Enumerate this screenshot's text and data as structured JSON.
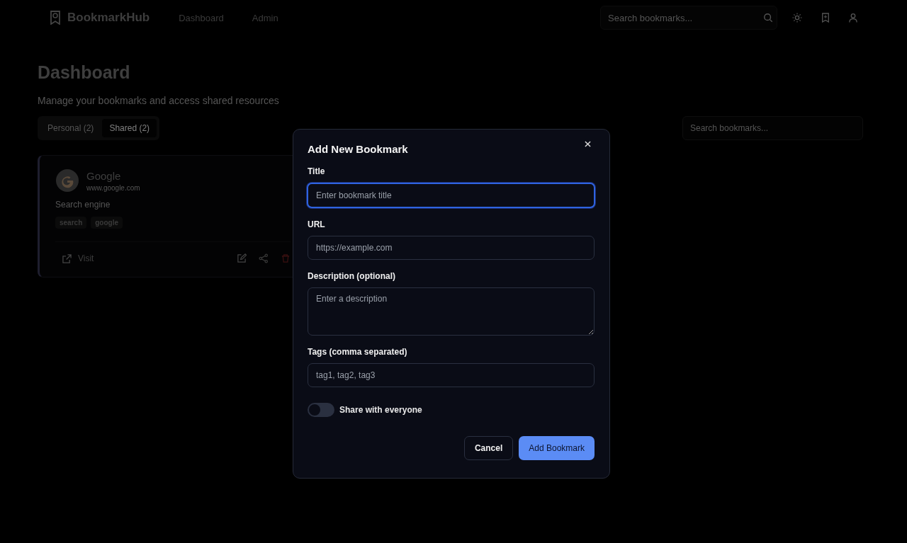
{
  "header": {
    "logo": "BookmarkHub",
    "nav": [
      {
        "label": "Dashboard"
      },
      {
        "label": "Admin"
      }
    ],
    "search": {
      "placeholder": "Search bookmarks..."
    }
  },
  "page": {
    "title": "Dashboard",
    "subtitle": "Manage your bookmarks and access shared resources",
    "tabs": [
      {
        "label": "Personal (2)",
        "selected": false
      },
      {
        "label": "Shared (2)",
        "selected": true
      }
    ],
    "search": {
      "placeholder": "Search bookmarks..."
    },
    "bookmarks": [
      {
        "title": "Google",
        "url": "www.google.com",
        "description": "Search engine",
        "tags": [
          "search",
          "google"
        ],
        "visit": "Visit"
      }
    ]
  },
  "dialog": {
    "title": "Add New Bookmark",
    "fields": [
      {
        "kind": "input",
        "label": "Title",
        "placeholder": "Enter bookmark title",
        "focused": true
      },
      {
        "kind": "input",
        "label": "URL",
        "placeholder": "https://example.com",
        "focused": false
      },
      {
        "kind": "textarea",
        "label": "Description (optional)",
        "placeholder": "Enter a description",
        "focused": false
      },
      {
        "kind": "input",
        "label": "Tags (comma separated)",
        "placeholder": "tag1, tag2, tag3",
        "focused": false
      }
    ],
    "toggle": {
      "label": "Share with everyone",
      "on": false
    },
    "buttons": [
      {
        "label": "Cancel",
        "kind": "secondary"
      },
      {
        "label": "Add Bookmark",
        "kind": "primary"
      }
    ]
  }
}
